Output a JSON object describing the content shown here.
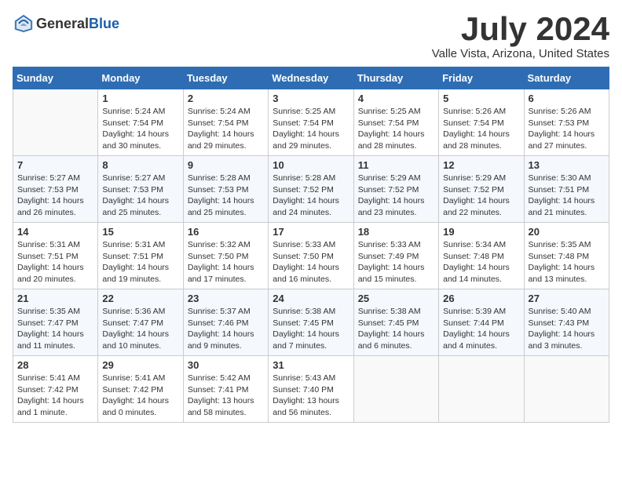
{
  "header": {
    "logo_general": "General",
    "logo_blue": "Blue",
    "main_title": "July 2024",
    "subtitle": "Valle Vista, Arizona, United States"
  },
  "calendar": {
    "days_of_week": [
      "Sunday",
      "Monday",
      "Tuesday",
      "Wednesday",
      "Thursday",
      "Friday",
      "Saturday"
    ],
    "weeks": [
      [
        {
          "day": "",
          "info": ""
        },
        {
          "day": "1",
          "info": "Sunrise: 5:24 AM\nSunset: 7:54 PM\nDaylight: 14 hours\nand 30 minutes."
        },
        {
          "day": "2",
          "info": "Sunrise: 5:24 AM\nSunset: 7:54 PM\nDaylight: 14 hours\nand 29 minutes."
        },
        {
          "day": "3",
          "info": "Sunrise: 5:25 AM\nSunset: 7:54 PM\nDaylight: 14 hours\nand 29 minutes."
        },
        {
          "day": "4",
          "info": "Sunrise: 5:25 AM\nSunset: 7:54 PM\nDaylight: 14 hours\nand 28 minutes."
        },
        {
          "day": "5",
          "info": "Sunrise: 5:26 AM\nSunset: 7:54 PM\nDaylight: 14 hours\nand 28 minutes."
        },
        {
          "day": "6",
          "info": "Sunrise: 5:26 AM\nSunset: 7:53 PM\nDaylight: 14 hours\nand 27 minutes."
        }
      ],
      [
        {
          "day": "7",
          "info": "Sunrise: 5:27 AM\nSunset: 7:53 PM\nDaylight: 14 hours\nand 26 minutes."
        },
        {
          "day": "8",
          "info": "Sunrise: 5:27 AM\nSunset: 7:53 PM\nDaylight: 14 hours\nand 25 minutes."
        },
        {
          "day": "9",
          "info": "Sunrise: 5:28 AM\nSunset: 7:53 PM\nDaylight: 14 hours\nand 25 minutes."
        },
        {
          "day": "10",
          "info": "Sunrise: 5:28 AM\nSunset: 7:52 PM\nDaylight: 14 hours\nand 24 minutes."
        },
        {
          "day": "11",
          "info": "Sunrise: 5:29 AM\nSunset: 7:52 PM\nDaylight: 14 hours\nand 23 minutes."
        },
        {
          "day": "12",
          "info": "Sunrise: 5:29 AM\nSunset: 7:52 PM\nDaylight: 14 hours\nand 22 minutes."
        },
        {
          "day": "13",
          "info": "Sunrise: 5:30 AM\nSunset: 7:51 PM\nDaylight: 14 hours\nand 21 minutes."
        }
      ],
      [
        {
          "day": "14",
          "info": "Sunrise: 5:31 AM\nSunset: 7:51 PM\nDaylight: 14 hours\nand 20 minutes."
        },
        {
          "day": "15",
          "info": "Sunrise: 5:31 AM\nSunset: 7:51 PM\nDaylight: 14 hours\nand 19 minutes."
        },
        {
          "day": "16",
          "info": "Sunrise: 5:32 AM\nSunset: 7:50 PM\nDaylight: 14 hours\nand 17 minutes."
        },
        {
          "day": "17",
          "info": "Sunrise: 5:33 AM\nSunset: 7:50 PM\nDaylight: 14 hours\nand 16 minutes."
        },
        {
          "day": "18",
          "info": "Sunrise: 5:33 AM\nSunset: 7:49 PM\nDaylight: 14 hours\nand 15 minutes."
        },
        {
          "day": "19",
          "info": "Sunrise: 5:34 AM\nSunset: 7:48 PM\nDaylight: 14 hours\nand 14 minutes."
        },
        {
          "day": "20",
          "info": "Sunrise: 5:35 AM\nSunset: 7:48 PM\nDaylight: 14 hours\nand 13 minutes."
        }
      ],
      [
        {
          "day": "21",
          "info": "Sunrise: 5:35 AM\nSunset: 7:47 PM\nDaylight: 14 hours\nand 11 minutes."
        },
        {
          "day": "22",
          "info": "Sunrise: 5:36 AM\nSunset: 7:47 PM\nDaylight: 14 hours\nand 10 minutes."
        },
        {
          "day": "23",
          "info": "Sunrise: 5:37 AM\nSunset: 7:46 PM\nDaylight: 14 hours\nand 9 minutes."
        },
        {
          "day": "24",
          "info": "Sunrise: 5:38 AM\nSunset: 7:45 PM\nDaylight: 14 hours\nand 7 minutes."
        },
        {
          "day": "25",
          "info": "Sunrise: 5:38 AM\nSunset: 7:45 PM\nDaylight: 14 hours\nand 6 minutes."
        },
        {
          "day": "26",
          "info": "Sunrise: 5:39 AM\nSunset: 7:44 PM\nDaylight: 14 hours\nand 4 minutes."
        },
        {
          "day": "27",
          "info": "Sunrise: 5:40 AM\nSunset: 7:43 PM\nDaylight: 14 hours\nand 3 minutes."
        }
      ],
      [
        {
          "day": "28",
          "info": "Sunrise: 5:41 AM\nSunset: 7:42 PM\nDaylight: 14 hours\nand 1 minute."
        },
        {
          "day": "29",
          "info": "Sunrise: 5:41 AM\nSunset: 7:42 PM\nDaylight: 14 hours\nand 0 minutes."
        },
        {
          "day": "30",
          "info": "Sunrise: 5:42 AM\nSunset: 7:41 PM\nDaylight: 13 hours\nand 58 minutes."
        },
        {
          "day": "31",
          "info": "Sunrise: 5:43 AM\nSunset: 7:40 PM\nDaylight: 13 hours\nand 56 minutes."
        },
        {
          "day": "",
          "info": ""
        },
        {
          "day": "",
          "info": ""
        },
        {
          "day": "",
          "info": ""
        }
      ]
    ]
  }
}
